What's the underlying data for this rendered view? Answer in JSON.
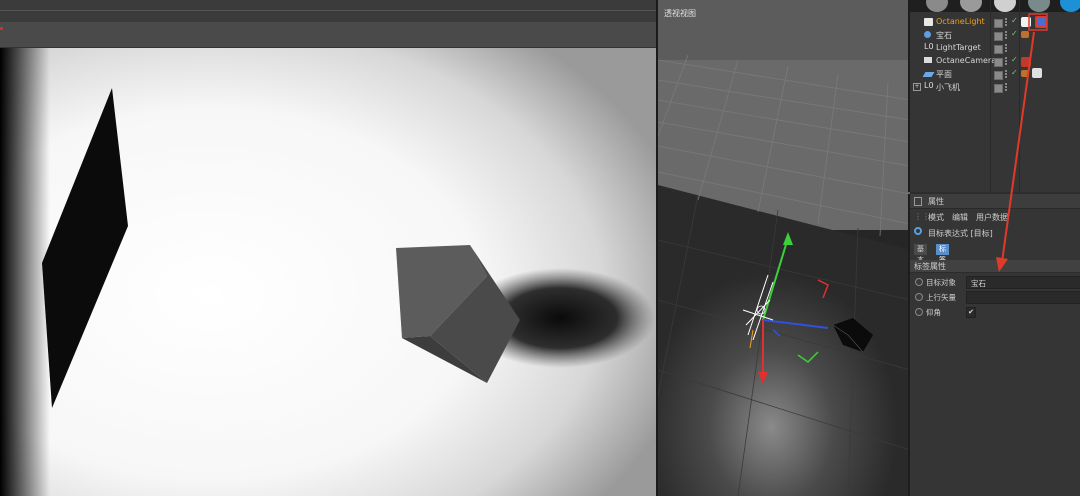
{
  "viewport": {
    "title": "透视视图"
  },
  "objects": {
    "items": [
      {
        "name": "OctaneLight",
        "selected": true
      },
      {
        "name": "宝石",
        "selected": false
      },
      {
        "name": "LightTarget",
        "selected": false
      },
      {
        "name": "OctaneCamera",
        "selected": false
      },
      {
        "name": "平面",
        "selected": false
      },
      {
        "name": "小飞机",
        "selected": false
      }
    ]
  },
  "attributes": {
    "header": "属性",
    "menu": [
      "模式",
      "编辑",
      "用户数据"
    ],
    "tag_title": "目标表达式 [目标]",
    "tabs": [
      "基本",
      "标签"
    ],
    "section": "标签属性",
    "props": [
      {
        "label": "目标对象",
        "value": "宝石"
      },
      {
        "label": "上行矢量",
        "value": ""
      },
      {
        "label": "仰角",
        "value": "✔"
      }
    ]
  },
  "colors": {
    "selected": "#f0a020",
    "annotation": "#e03a2a",
    "highlight": "#5aa0e0"
  }
}
